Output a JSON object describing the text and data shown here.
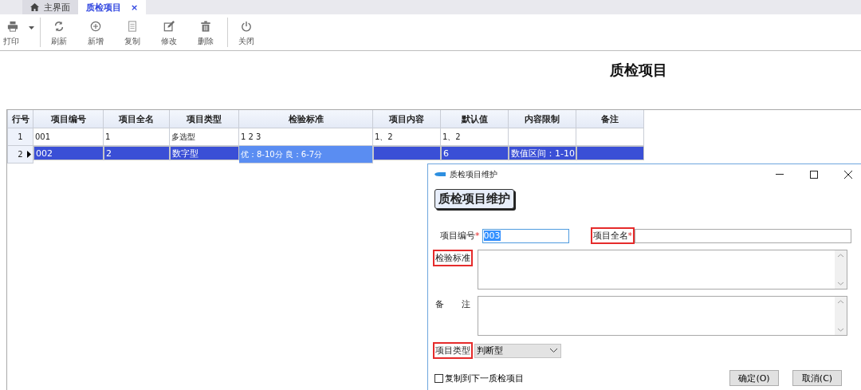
{
  "tabs": [
    {
      "label": "主界面",
      "selected": false
    },
    {
      "label": "质检项目",
      "selected": true,
      "close_label": "×"
    }
  ],
  "toolbar": [
    {
      "items": [
        {
          "label": "打印",
          "has_menu": true
        }
      ]
    },
    {
      "items": [
        {
          "label": "刷新",
          "has_menu": false
        },
        {
          "label": "新增",
          "has_menu": false
        },
        {
          "label": "复制",
          "has_menu": false
        },
        {
          "label": "修改",
          "has_menu": false
        },
        {
          "label": "删除",
          "has_menu": false
        }
      ]
    },
    {
      "items": [
        {
          "label": "关闭",
          "has_menu": false
        }
      ]
    }
  ],
  "page_title": "质检项目",
  "table": {
    "columns": [
      "行号",
      "项目编号",
      "项目全名",
      "项目类型",
      "检验标准",
      "项目内容",
      "默认值",
      "内容限制",
      "备注"
    ],
    "rows": [
      {
        "selected": false,
        "cells": [
          {
            "text": "1",
            "focused": false
          },
          {
            "text": "001",
            "focused": false
          },
          {
            "text": "1",
            "focused": false
          },
          {
            "text": "多选型",
            "focused": false
          },
          {
            "text": "1  2 3",
            "focused": false
          },
          {
            "text": "1、2",
            "focused": false
          },
          {
            "text": "1、2",
            "focused": false
          },
          {
            "text": "",
            "focused": false
          },
          {
            "text": "",
            "focused": false
          }
        ]
      },
      {
        "selected": true,
        "cells": [
          {
            "text": "2",
            "focused": false
          },
          {
            "text": "002",
            "focused": false
          },
          {
            "text": "2",
            "focused": false
          },
          {
            "text": "数字型",
            "focused": false
          },
          {
            "text": "优：8-10分  良：6-7分",
            "focused": true
          },
          {
            "text": "",
            "focused": false
          },
          {
            "text": "6",
            "focused": false
          },
          {
            "text": "数值区间：1-10",
            "focused": false
          },
          {
            "text": "",
            "focused": false
          }
        ]
      }
    ]
  },
  "dialog": {
    "title": "质检项目维护",
    "heading": "质检项目维护",
    "row_fields": [
      {
        "label": "项目编号",
        "required_mark": "*",
        "highlighted": false,
        "value": "003",
        "focused": true,
        "text_selected": true
      },
      {
        "label": "项目全名",
        "required_mark": "*",
        "highlighted": true,
        "focused": false
      }
    ],
    "text_areas": [
      {
        "label": "检验标准",
        "highlighted": true
      },
      {
        "label": "备　　注",
        "highlighted": false
      }
    ],
    "type_field": {
      "label": "项目类型",
      "highlighted": true,
      "value": "判断型"
    },
    "checkbox": {
      "label": "复制到下一质检项目",
      "checked": false
    },
    "buttons": [
      "确定(O)",
      "取消(C)"
    ]
  }
}
